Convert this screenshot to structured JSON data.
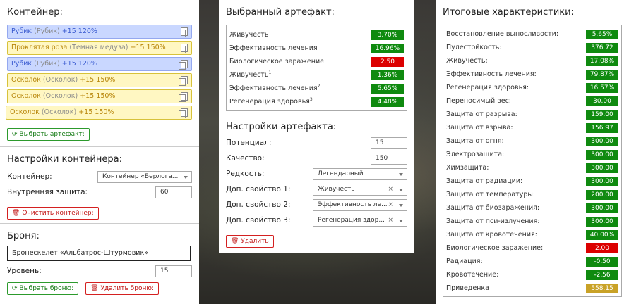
{
  "colors": {
    "green": "#0f8a0f",
    "red": "#dc0000",
    "gold": "#c9a227",
    "blue_item": "#c9d7ff",
    "yellow_item": "#fff7c2"
  },
  "container": {
    "title": "Контейнер:",
    "items": [
      {
        "name": "Рубик",
        "sub": "(Рубик)",
        "bonus": " +15 120%",
        "style": "blue"
      },
      {
        "name": "Проклятая роза",
        "sub": "(Темная медуза)",
        "bonus": " +15 150%",
        "style": "yellow"
      },
      {
        "name": "Рубик",
        "sub": "(Рубик)",
        "bonus": " +15 120%",
        "style": "blue"
      },
      {
        "name": "Осколок",
        "sub": "(Осколок)",
        "bonus": " +15 150%",
        "style": "yellow"
      },
      {
        "name": "Осколок",
        "sub": "(Осколок)",
        "bonus": " +15 150%",
        "style": "yellow"
      },
      {
        "name": "Осколок",
        "sub": "(Осколок)",
        "bonus": " +15 150%",
        "style": "yellow"
      }
    ],
    "select_button": "Выбрать артефакт:"
  },
  "container_settings": {
    "title": "Настройки контейнера:",
    "container_label": "Контейнер:",
    "container_value": "Контейнер «Берлога...",
    "protection_label": "Внутренняя защита:",
    "protection_value": "60",
    "clear_button": "Очистить контейнер:"
  },
  "armor": {
    "title": "Броня:",
    "value": "Бронескелет «Альбатрос-Штурмовик»",
    "level_label": "Уровень:",
    "level_value": "15",
    "select_button": "Выбрать броню:",
    "delete_button": "Удалить броню:"
  },
  "selected": {
    "title": "Выбранный артефакт:",
    "stats": [
      {
        "name": "Живучесть",
        "sup": "",
        "value": "3.70%",
        "color": "green"
      },
      {
        "name": "Эффективность лечения",
        "sup": "",
        "value": "16.96%",
        "color": "green"
      },
      {
        "name": "Биологическое заражение",
        "sup": "",
        "value": "2.50",
        "color": "red"
      },
      {
        "name": "Живучесть",
        "sup": "1",
        "value": "1.36%",
        "color": "green"
      },
      {
        "name": "Эффективность лечения",
        "sup": "2",
        "value": "5.65%",
        "color": "green"
      },
      {
        "name": "Регенерация здоровья",
        "sup": "3",
        "value": "4.48%",
        "color": "green"
      }
    ]
  },
  "artifact_settings": {
    "title": "Настройки артефакта:",
    "potential_label": "Потенциал:",
    "potential_value": "15",
    "quality_label": "Качество:",
    "quality_value": "150",
    "rarity_label": "Редкость:",
    "rarity_value": "Легендарный",
    "extra1_label": "Доп. свойство 1:",
    "extra1_value": "Живучесть",
    "extra2_label": "Доп. свойство 2:",
    "extra2_value": "Эффективность ле...",
    "extra3_label": "Доп. свойство 3:",
    "extra3_value": "Регенерация здор...",
    "delete_button": "Удалить"
  },
  "totals": {
    "title": "Итоговые характеристики:",
    "stats": [
      {
        "name": "Восстановление выносливости:",
        "value": "5.65%",
        "color": "green"
      },
      {
        "name": "Пулестойкость:",
        "value": "376.72",
        "color": "green"
      },
      {
        "name": "Живучесть:",
        "value": "17.08%",
        "color": "green"
      },
      {
        "name": "Эффективность лечения:",
        "value": "79.87%",
        "color": "green"
      },
      {
        "name": "Регенерация здоровья:",
        "value": "16.57%",
        "color": "green"
      },
      {
        "name": "Переносимый вес:",
        "value": "30.00",
        "color": "green"
      },
      {
        "name": "Защита от разрыва:",
        "value": "159.00",
        "color": "green"
      },
      {
        "name": "Защита от взрыва:",
        "value": "156.97",
        "color": "green"
      },
      {
        "name": "Защита от огня:",
        "value": "300.00",
        "color": "green"
      },
      {
        "name": "Электрозащита:",
        "value": "300.00",
        "color": "green"
      },
      {
        "name": "Химзащита:",
        "value": "300.00",
        "color": "green"
      },
      {
        "name": "Защита от радиации:",
        "value": "300.00",
        "color": "green"
      },
      {
        "name": "Защита от температуры:",
        "value": "200.00",
        "color": "green"
      },
      {
        "name": "Защита от биозаражения:",
        "value": "300.00",
        "color": "green"
      },
      {
        "name": "Защита от пси-излучения:",
        "value": "300.00",
        "color": "green"
      },
      {
        "name": "Защита от кровотечения:",
        "value": "40.00%",
        "color": "green"
      },
      {
        "name": "Биологическое заражение:",
        "value": "2.00",
        "color": "red"
      },
      {
        "name": "Радиация:",
        "value": "-0.50",
        "color": "green"
      },
      {
        "name": "Кровотечение:",
        "value": "-2.56",
        "color": "green"
      },
      {
        "name": "Приведенка",
        "value": "558.15",
        "color": "gold"
      }
    ]
  }
}
